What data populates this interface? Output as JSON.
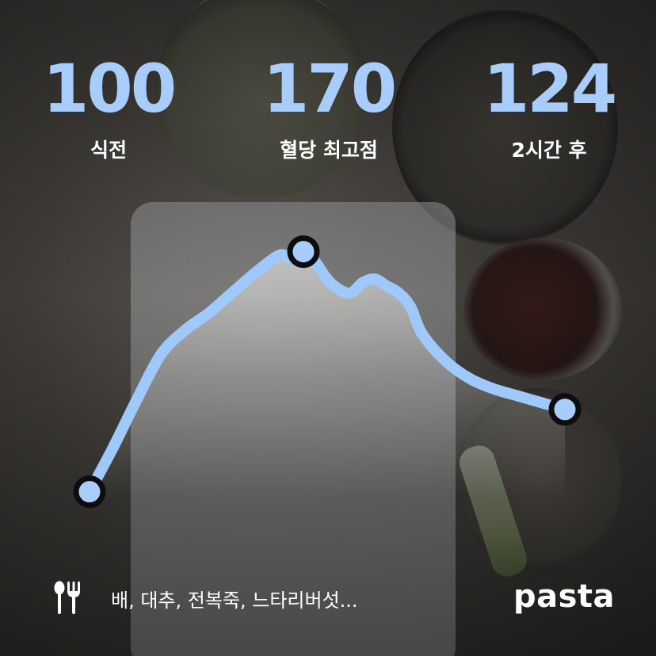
{
  "stats": [
    {
      "value": "100",
      "label": "식전"
    },
    {
      "value": "170",
      "label": "혈당 최고점"
    },
    {
      "value": "124",
      "label": "2시간 후"
    }
  ],
  "footer": {
    "foods": "배, 대추, 전복죽, 느타리버섯...",
    "brand": "pasta"
  },
  "colors": {
    "accent": "#a9cdfb",
    "line": "#9fc8fb",
    "marker_fill": "#a9cdfb",
    "marker_stroke": "#0d0d0f"
  },
  "icons": {
    "utensil": "fork-spoon-icon"
  },
  "chart_data": {
    "type": "line",
    "x": [
      0,
      6,
      12,
      18,
      24,
      30,
      36,
      42,
      48,
      51,
      54,
      57,
      60,
      63,
      66,
      69,
      72,
      75,
      78,
      81,
      84,
      90,
      96,
      102,
      108,
      114,
      120
    ],
    "values": [
      100,
      113,
      127,
      140,
      147,
      152,
      158,
      164,
      169,
      168,
      170,
      167,
      162,
      159,
      158,
      161,
      162,
      160,
      158,
      154,
      146,
      138,
      133,
      130,
      128,
      126,
      124
    ],
    "markers": [
      {
        "x": 0,
        "y": 100
      },
      {
        "x": 54,
        "y": 170
      },
      {
        "x": 120,
        "y": 124
      }
    ],
    "ylim": [
      96,
      178
    ]
  }
}
